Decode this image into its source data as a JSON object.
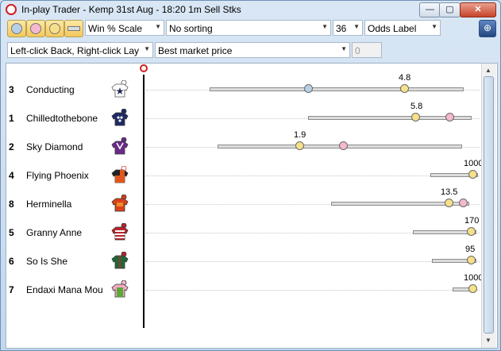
{
  "window": {
    "title": "In-play Trader - Kemp 31st Aug - 18:20 1m Sell Stks"
  },
  "window_buttons": {
    "minimize": "—",
    "maximize": "▢",
    "close": "✕"
  },
  "toolbar": {
    "buttons": [
      "blue-circle",
      "pink-circle",
      "yellow-circle",
      "grey-bar"
    ],
    "scale": "Win % Scale",
    "sorting": "No sorting",
    "size": "36",
    "label_mode": "Odds Label",
    "pin_glyph": "⊕"
  },
  "toolbar2": {
    "click_mode": "Left-click Back, Right-click Lay",
    "price_mode": "Best market price",
    "stake": "0"
  },
  "colors": {
    "blue": "#b7d0e6",
    "yellow": "#f7e08a",
    "pink": "#f4b8cf"
  },
  "runners": [
    {
      "number": "3",
      "name": "Conducting",
      "odds_label": "4.8"
    },
    {
      "number": "1",
      "name": "Chilledtothebone",
      "odds_label": "5.8"
    },
    {
      "number": "2",
      "name": "Sky Diamond",
      "odds_label": "1.9"
    },
    {
      "number": "4",
      "name": "Flying Phoenix",
      "odds_label": "1000"
    },
    {
      "number": "8",
      "name": "Herminella",
      "odds_label": "13.5"
    },
    {
      "number": "5",
      "name": "Granny Anne",
      "odds_label": "170"
    },
    {
      "number": "6",
      "name": "So Is She",
      "odds_label": "95"
    },
    {
      "number": "7",
      "name": "Endaxi Mana Mou",
      "odds_label": "1000"
    }
  ]
}
